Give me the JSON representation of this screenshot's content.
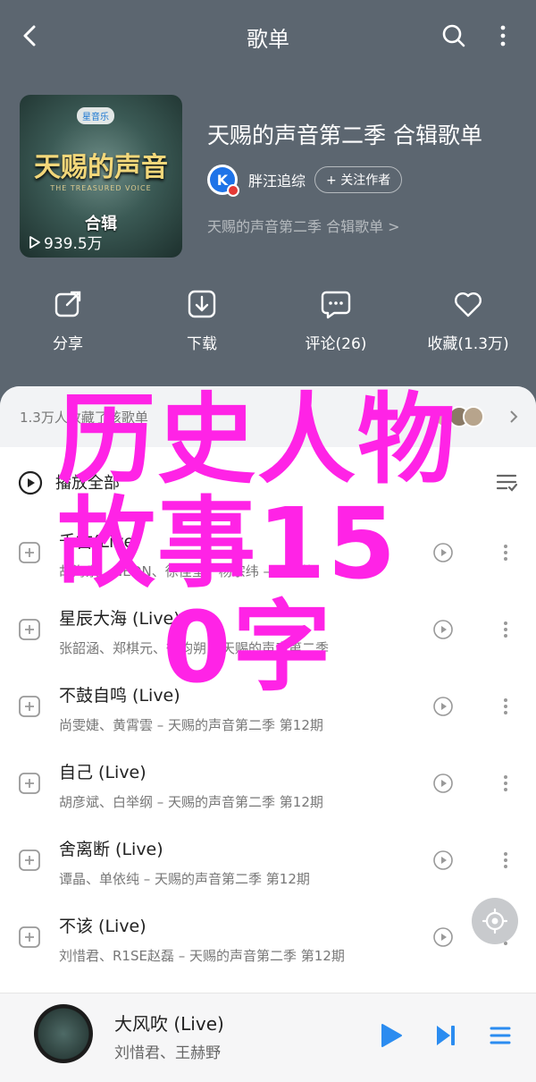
{
  "header": {
    "title": "歌单"
  },
  "playlist": {
    "cover": {
      "badge": "星音乐",
      "title": "天赐的声音",
      "subtitle": "THE TREASURED VOICE",
      "label": "合辑",
      "plays": "939.5万"
    },
    "title": "天赐的声音第二季 合辑歌单",
    "creator": "胖汪追综",
    "follow_label": "+ 关注作者",
    "description": "天赐的声音第二季 合辑歌单 >"
  },
  "actions": [
    {
      "label": "分享",
      "icon": "share-icon"
    },
    {
      "label": "下载",
      "icon": "download-icon"
    },
    {
      "label": "评论(26)",
      "icon": "comment-icon"
    },
    {
      "label": "收藏(1.3万)",
      "icon": "heart-icon"
    }
  ],
  "collect": {
    "text": "1.3万人收藏了该歌单"
  },
  "play_all": {
    "label": "播放全部"
  },
  "songs": [
    {
      "title": "千古(Live)",
      "subtitle": "胡海泉、NEON、徐佳莹、杨宗纬 – 天赐的"
    },
    {
      "title": "星辰大海 (Live)",
      "subtitle": "张韶涵、郑棋元、徐均朔 – 天赐的声音第二季"
    },
    {
      "title": "不鼓自鸣 (Live)",
      "subtitle": "尚雯婕、黄霄雲 – 天赐的声音第二季 第12期"
    },
    {
      "title": "自己 (Live)",
      "subtitle": "胡彦斌、白举纲 – 天赐的声音第二季 第12期"
    },
    {
      "title": "舍离断 (Live)",
      "subtitle": "谭晶、单依纯 – 天赐的声音第二季 第12期"
    },
    {
      "title": "不该 (Live)",
      "subtitle": "刘惜君、R1SE赵磊 – 天赐的声音第二季 第12期"
    }
  ],
  "player": {
    "title": "大风吹 (Live)",
    "subtitle": "刘惜君、王赫野"
  },
  "watermark": {
    "line1": "历史人物",
    "line2": "故事15",
    "line3": "0字"
  },
  "colors": {
    "accent": "#2b8cf0",
    "watermark": "#ff23e6",
    "header_bg": "#5c6670"
  }
}
